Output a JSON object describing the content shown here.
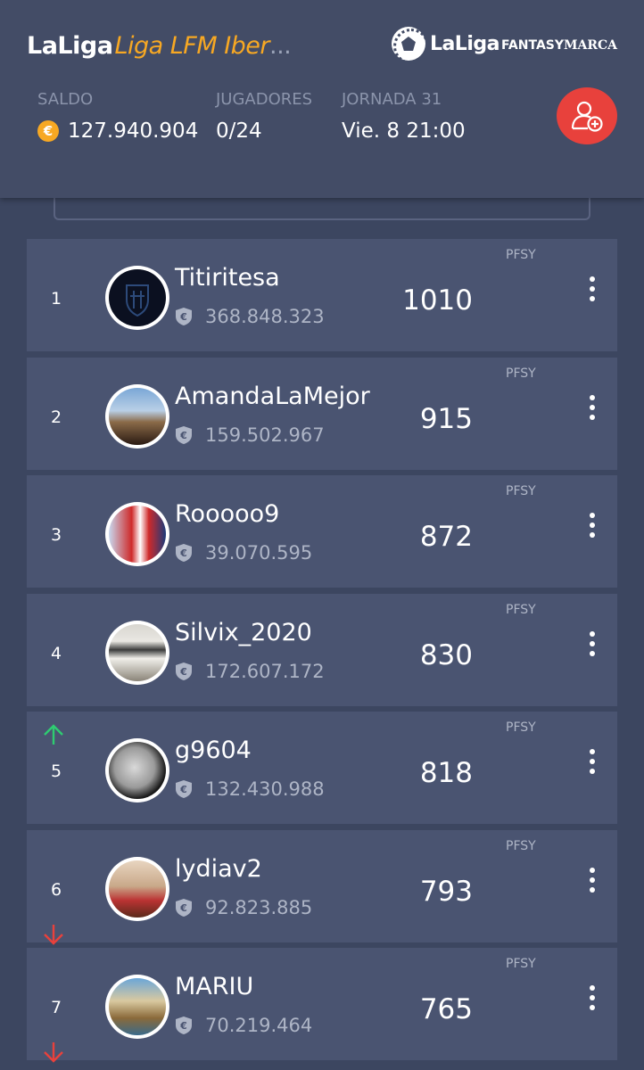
{
  "header": {
    "brand_prefix": "LaLiga",
    "league_name": "Liga LFM Iber",
    "ellipsis": "...",
    "logo_word": "LaLiga",
    "logo_fantasy": "FANTASY",
    "logo_marca": "MARCA",
    "stats": {
      "saldo_label": "SALDO",
      "saldo_value": "127.940.904",
      "coin_symbol": "€",
      "jugadores_label": "JUGADORES",
      "jugadores_value": "0/24",
      "jornada_label": "JORNADA 31",
      "jornada_value": "Vie. 8 21:00"
    },
    "add_button_icon": "add-user-icon"
  },
  "colors": {
    "background": "#3c4660",
    "header": "#434c66",
    "row": "#4a5471",
    "accent_orange": "#f7a823",
    "add_button": "#e8413c",
    "trend_up": "#2ecc71",
    "trend_down": "#e8413c"
  },
  "ranking": [
    {
      "position": "1",
      "name": "Titiritesa",
      "money": "368.848.323",
      "points": "1010",
      "tag": "PFSY",
      "trend": "none",
      "avatar": "club-crest-avatar"
    },
    {
      "position": "2",
      "name": "AmandaLaMejor",
      "money": "159.502.967",
      "points": "915",
      "tag": "PFSY",
      "trend": "none",
      "avatar": "photo-avatar"
    },
    {
      "position": "3",
      "name": "Rooooo9",
      "money": "39.070.595",
      "points": "872",
      "tag": "PFSY",
      "trend": "none",
      "avatar": "player-photo-avatar"
    },
    {
      "position": "4",
      "name": "Silvix_2020",
      "money": "172.607.172",
      "points": "830",
      "tag": "PFSY",
      "trend": "none",
      "avatar": "cap-photo-avatar"
    },
    {
      "position": "5",
      "name": "g9604",
      "money": "132.430.988",
      "points": "818",
      "tag": "PFSY",
      "trend": "up",
      "avatar": "moon-avatar"
    },
    {
      "position": "6",
      "name": "lydiav2",
      "money": "92.823.885",
      "points": "793",
      "tag": "PFSY",
      "trend": "down",
      "avatar": "photo-avatar"
    },
    {
      "position": "7",
      "name": "MARIU",
      "money": "70.219.464",
      "points": "765",
      "tag": "PFSY",
      "trend": "down",
      "avatar": "photo-avatar"
    }
  ]
}
